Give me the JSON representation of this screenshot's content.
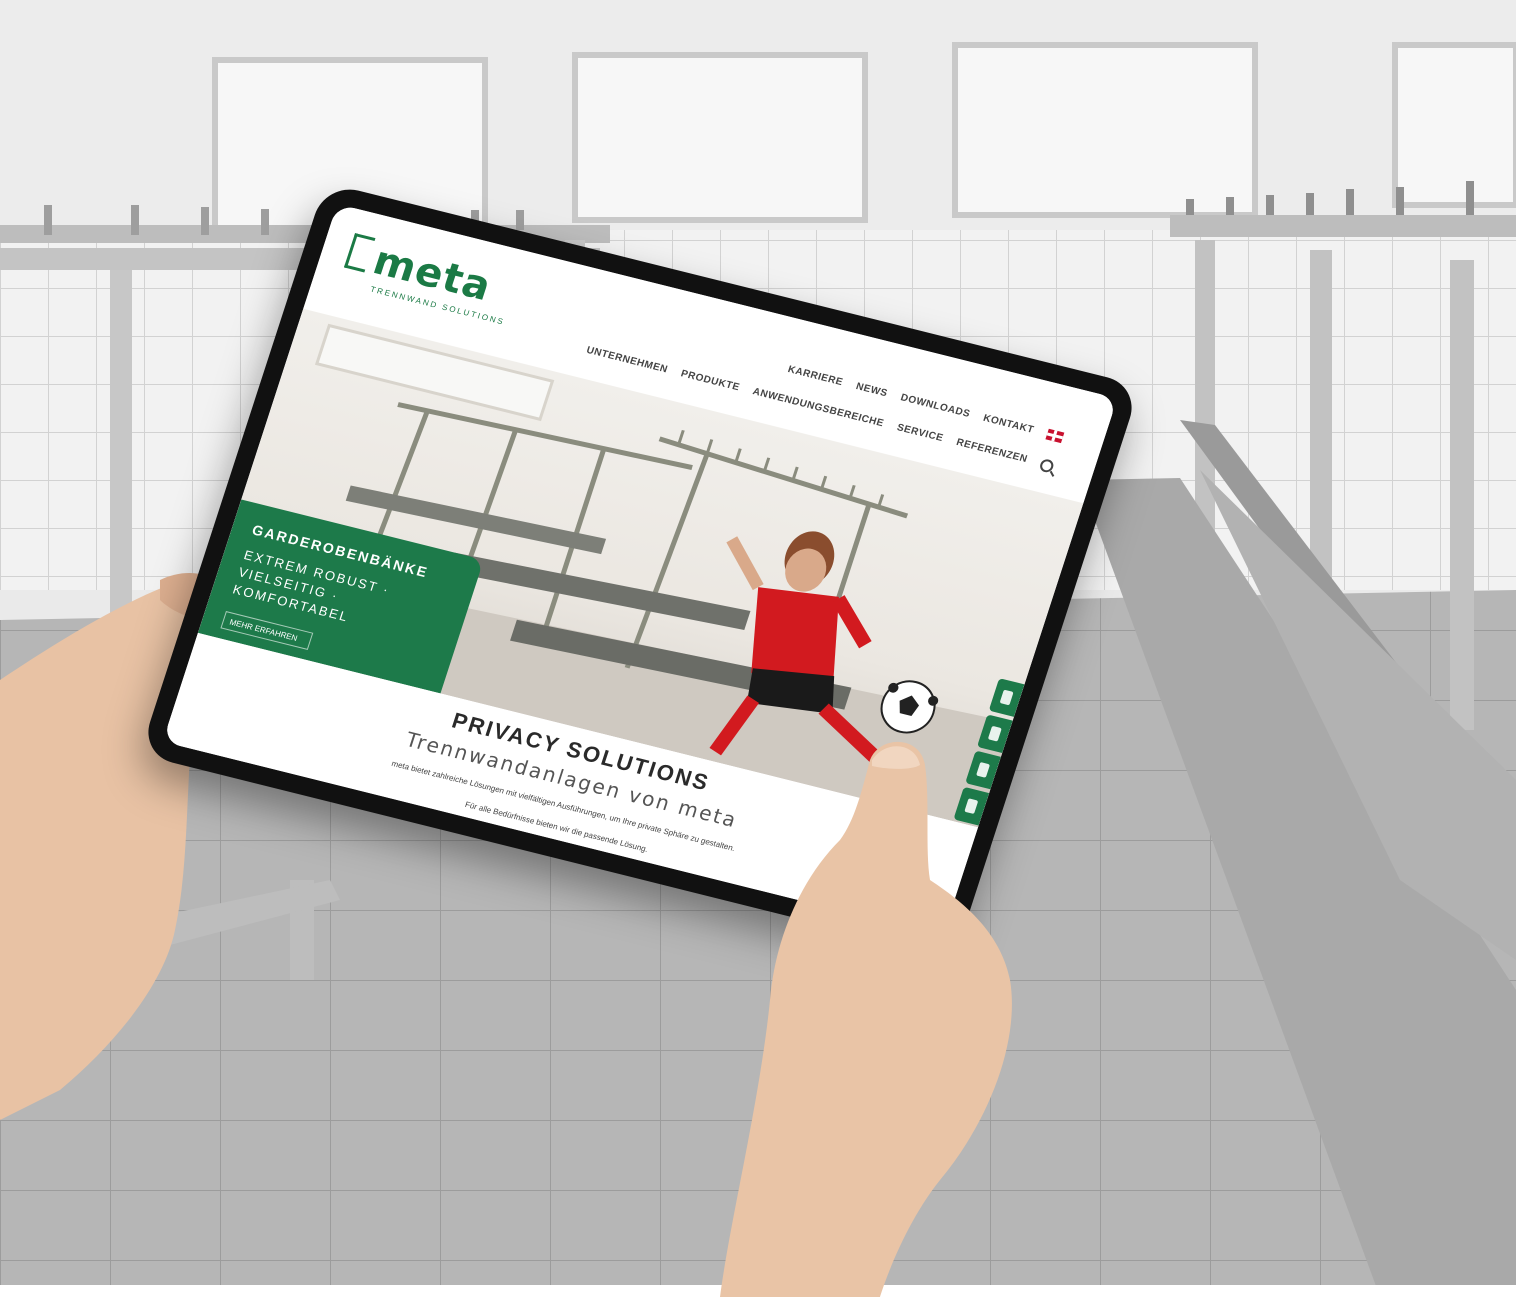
{
  "site": {
    "logo": "meta",
    "logo_sub": "TRENNWAND SOLUTIONS",
    "nav_top": [
      "KARRIERE",
      "NEWS",
      "DOWNLOADS",
      "KONTAKT"
    ],
    "nav_main": [
      "UNTERNEHMEN",
      "PRODUKTE",
      "ANWENDUNGSBEREICHE",
      "SERVICE",
      "REFERENZEN"
    ],
    "language_icon": "uk-flag-icon",
    "search_icon": "search-icon"
  },
  "hero": {
    "teaser_title": "GARDEROBENBÄNKE",
    "teaser_text": "EXTREM ROBUST · VIELSEITIG · KOMFORTABEL",
    "teaser_button": "MEHR ERFAHREN"
  },
  "content": {
    "headline": "PRIVACY SOLUTIONS",
    "subline": "Trennwandanlagen von meta",
    "body_line1": "meta bietet zahlreiche Lösungen mit vielfältigen Ausführungen, um Ihre private Sphäre zu gestalten.",
    "body_line2": "Für alle Bedürfnisse bieten wir die passende Lösung."
  },
  "colors": {
    "brand_green": "#1d7a4a",
    "jersey_red": "#d21a1f"
  }
}
